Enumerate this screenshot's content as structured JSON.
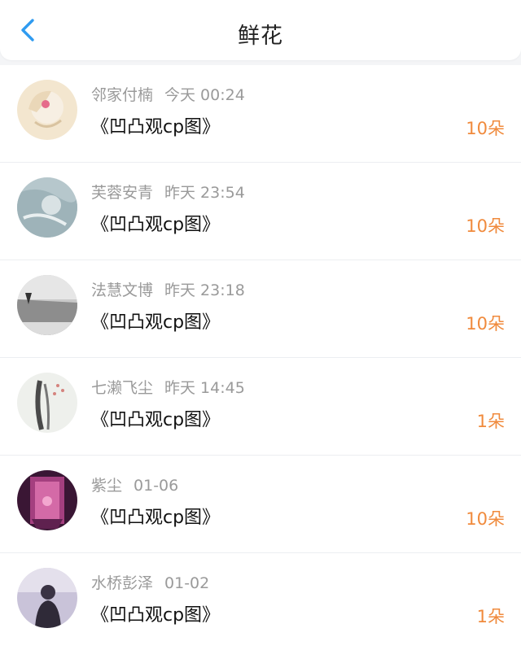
{
  "header": {
    "title": "鲜花",
    "back_icon": "chevron-left-icon",
    "accent_color": "#2f9bf0"
  },
  "flowers": [
    {
      "name": "邻家付楠",
      "time": "今天 00:24",
      "work": "《凹凸观cp图》",
      "count": "10朵"
    },
    {
      "name": "芙蓉安青",
      "time": "昨天 23:54",
      "work": "《凹凸观cp图》",
      "count": "10朵"
    },
    {
      "name": "法慧文博",
      "time": "昨天 23:18",
      "work": "《凹凸观cp图》",
      "count": "10朵"
    },
    {
      "name": "七濑飞尘",
      "time": "昨天 14:45",
      "work": "《凹凸观cp图》",
      "count": "1朵"
    },
    {
      "name": "紫尘",
      "time": "01-06",
      "work": "《凹凸观cp图》",
      "count": "10朵"
    },
    {
      "name": "水桥彭泽",
      "time": "01-02",
      "work": "《凹凸观cp图》",
      "count": "1朵"
    }
  ],
  "colors": {
    "count": "#f08a3c",
    "meta": "#9a9a9a",
    "text": "#111111"
  }
}
